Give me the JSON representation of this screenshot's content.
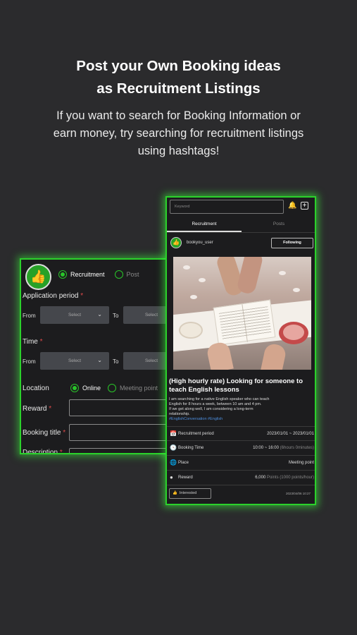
{
  "headline": {
    "line1": "Post your Own Booking ideas",
    "line2": "as Recruitment Listings"
  },
  "subtitle": {
    "line1": "If you want to search for Booking Information or",
    "line2": "earn money, try searching for recruitment listings",
    "line3": "using hashtags!"
  },
  "form": {
    "radio_recruitment": "Recruitment",
    "radio_post": "Post",
    "application_period_label": "Application period",
    "required_mark": "*",
    "from_label": "From",
    "to_label": "To",
    "select_placeholder": "Select",
    "time_label": "Time",
    "location_label": "Location",
    "online_label": "Online",
    "meeting_point_label": "Meeting point",
    "reward_label": "Reward",
    "booking_title_label": "Booking title",
    "description_label": "Description"
  },
  "phone": {
    "search_placeholder": "Keyword",
    "tabs": [
      "Recruitment",
      "Posts"
    ],
    "username": "bookyou_user",
    "follow_label": "Following",
    "post_title": "(High hourly rate) Looking for someone to teach English lessons",
    "post_body_line1": "I am searching for a native English speaker who can teach",
    "post_body_line2": "English for 8 hours a week, between 10 am and 4 pm.",
    "post_body_line3": "If we get along well, I am considering a long-term",
    "post_body_line4": "relationship.",
    "hashtags": "#EnglishConversation #English",
    "details": [
      {
        "icon": "calendar-icon",
        "label": "Recruitment period",
        "value": "2023/01/01 ~ 2023/01/01",
        "note": ""
      },
      {
        "icon": "clock-icon",
        "label": "Booking Time",
        "value": "10:00 ~ 16:00",
        "note": "(6hours 0minutes)"
      },
      {
        "icon": "globe-icon",
        "label": "Place",
        "value": "Meeting point",
        "note": ""
      },
      {
        "icon": "coin-icon",
        "label": "Reward",
        "value": "6,000",
        "note": "Points (1000 points/hour)"
      }
    ],
    "interested_label": "Interested",
    "timestamp": "2023/04/06 10:27"
  },
  "colors": {
    "accent_green": "#2bd12b",
    "background": "#2b2b2d",
    "hashtag_blue": "#4d8fe0"
  }
}
